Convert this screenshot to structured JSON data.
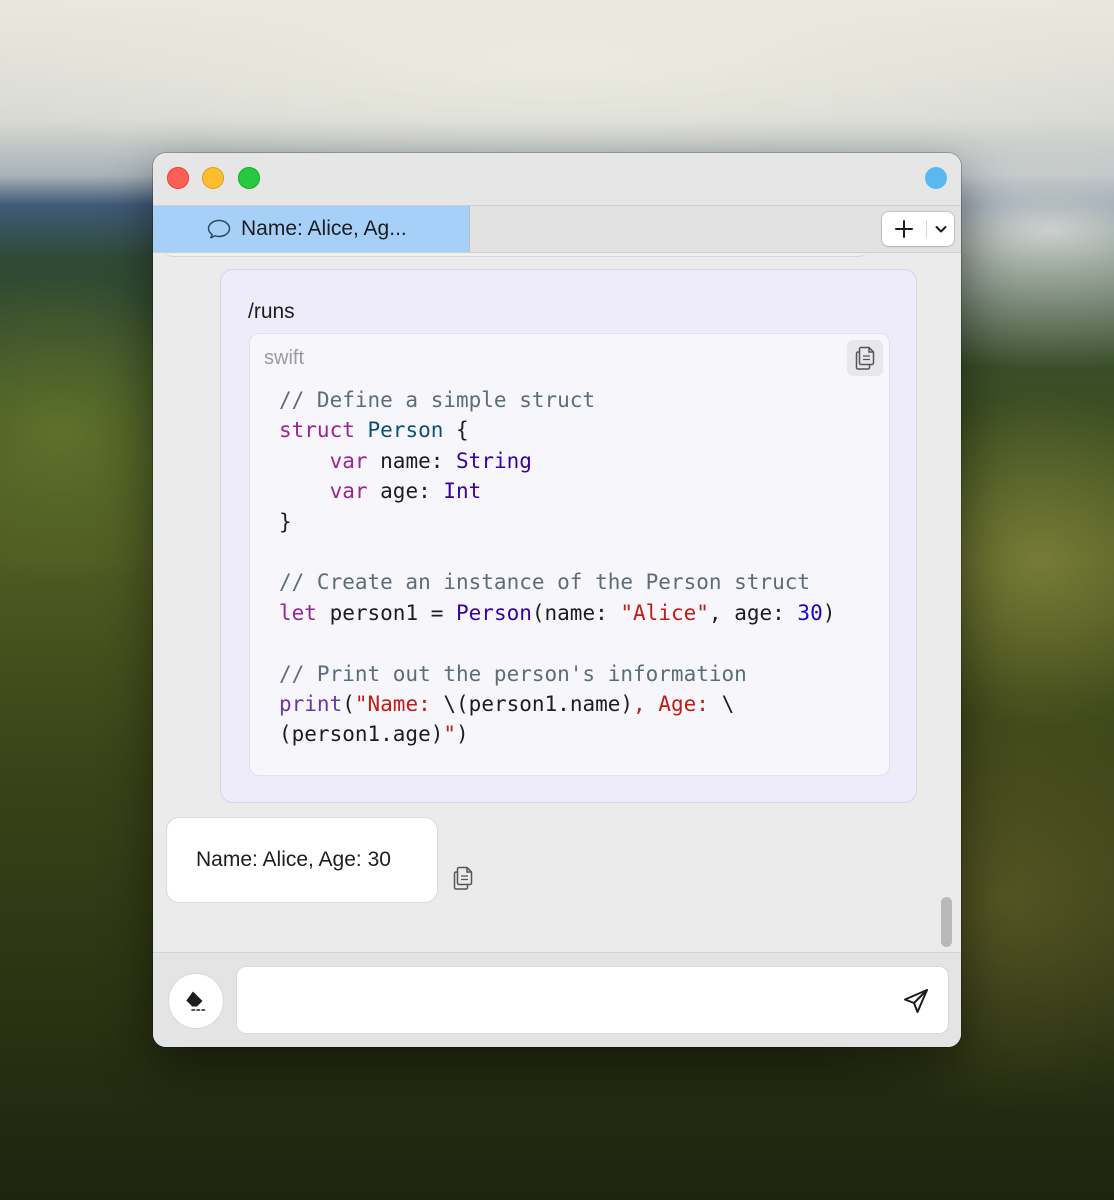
{
  "window": {
    "tab": {
      "label": "Name: Alice, Ag...",
      "icon": "chat-bubble-icon"
    },
    "tab_actions": {
      "new_tab_icon": "plus-icon",
      "menu_icon": "chevron-down-icon"
    },
    "status_color": "#5ab8f0"
  },
  "conversation": {
    "user_message": {
      "text": "/runs",
      "code_block": {
        "language": "swift",
        "copy_icon": "copy-icon",
        "lines": [
          [
            [
              "c-com",
              "// Define a simple struct"
            ]
          ],
          [
            [
              "c-kw",
              "struct"
            ],
            [
              "",
              " "
            ],
            [
              "c-decl",
              "Person"
            ],
            [
              "",
              " {"
            ]
          ],
          [
            [
              "",
              "    "
            ],
            [
              "c-kw",
              "var"
            ],
            [
              "",
              " name: "
            ],
            [
              "c-type",
              "String"
            ]
          ],
          [
            [
              "",
              "    "
            ],
            [
              "c-kw",
              "var"
            ],
            [
              "",
              " age: "
            ],
            [
              "c-type",
              "Int"
            ]
          ],
          [
            [
              "",
              "}"
            ]
          ],
          [],
          [
            [
              "c-com",
              "// Create an instance of the Person struct"
            ]
          ],
          [
            [
              "c-kw",
              "let"
            ],
            [
              "",
              " person1 = "
            ],
            [
              "c-type",
              "Person"
            ],
            [
              "",
              "(name: "
            ],
            [
              "c-str",
              "\"Alice\""
            ],
            [
              "",
              ", age: "
            ],
            [
              "c-num",
              "30"
            ],
            [
              "",
              ")"
            ]
          ],
          [],
          [
            [
              "c-com",
              "// Print out the person's information"
            ]
          ],
          [
            [
              "c-fn",
              "print"
            ],
            [
              "",
              "("
            ],
            [
              "c-str",
              "\"Name: "
            ],
            [
              "",
              "\\(person1.name)"
            ],
            [
              "c-str",
              ", Age: "
            ],
            [
              "",
              "\\"
            ]
          ],
          [
            [
              "",
              "(person1.age)"
            ],
            [
              "c-str",
              "\""
            ],
            [
              "",
              ")"
            ]
          ]
        ]
      }
    },
    "assistant_message": {
      "text": "Name: Alice, Age: 30",
      "copy_icon": "copy-icon"
    }
  },
  "composer": {
    "input_value": "",
    "input_placeholder": "",
    "clear_icon": "eraser-icon",
    "send_icon": "paper-plane-icon"
  }
}
